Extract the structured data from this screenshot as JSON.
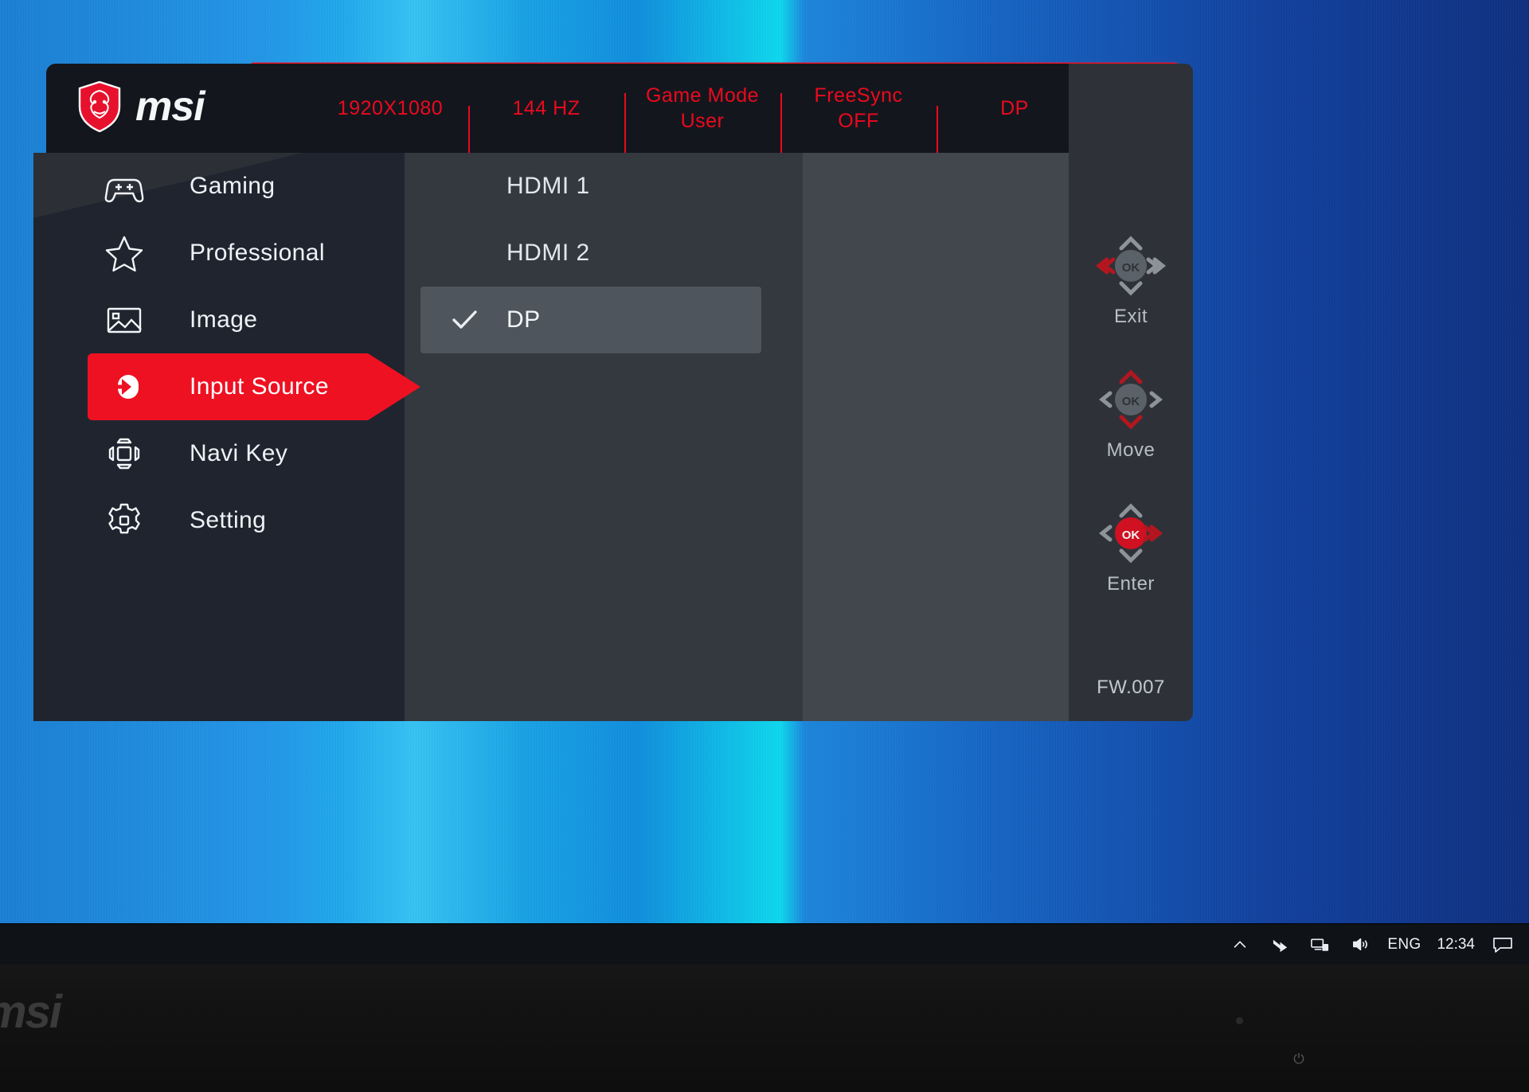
{
  "brand": {
    "logo_text": "msi",
    "logo_icon": "msi-dragon-shield-icon",
    "bezel_logo_text": "msi"
  },
  "status_bar": {
    "items": [
      {
        "line1": "1920X1080",
        "line2": ""
      },
      {
        "line1": "144 HZ",
        "line2": ""
      },
      {
        "line1": "Game Mode",
        "line2": "User"
      },
      {
        "line1": "FreeSync",
        "line2": "OFF"
      },
      {
        "line1": "DP",
        "line2": ""
      }
    ]
  },
  "sidebar": {
    "items": [
      {
        "label": "Gaming",
        "icon": "gamepad-icon",
        "active": false
      },
      {
        "label": "Professional",
        "icon": "star-icon",
        "active": false
      },
      {
        "label": "Image",
        "icon": "picture-icon",
        "active": false
      },
      {
        "label": "Input Source",
        "icon": "input-arrow-icon",
        "active": true
      },
      {
        "label": "Navi Key",
        "icon": "dpad-icon",
        "active": false
      },
      {
        "label": "Setting",
        "icon": "gear-icon",
        "active": false
      }
    ]
  },
  "options": {
    "items": [
      {
        "label": "HDMI 1",
        "selected": false
      },
      {
        "label": "HDMI 2",
        "selected": false
      },
      {
        "label": "DP",
        "selected": true
      }
    ],
    "check_icon": "check-icon"
  },
  "navkeys": {
    "clusters": [
      {
        "label": "Exit",
        "ok_text": "OK",
        "ok_style": "gray"
      },
      {
        "label": "Move",
        "ok_text": "OK",
        "ok_style": "gray"
      },
      {
        "label": "Enter",
        "ok_text": "OK",
        "ok_style": "red"
      }
    ],
    "firmware": "FW.007"
  },
  "taskbar": {
    "show_hidden_icons": "chevron-up-icon",
    "icons": [
      "chevron-up-icon",
      "onedrive-icon",
      "network-icon",
      "volume-icon"
    ],
    "language": "ENG",
    "clock": "12:34",
    "action_center": "notification-icon"
  },
  "colors": {
    "accent_red": "#ee1122",
    "status_red": "#ea0a1e",
    "osd_dark": "#20242f",
    "osd_panel": "#34383f",
    "desktop_blue": "#1a7fd4"
  }
}
